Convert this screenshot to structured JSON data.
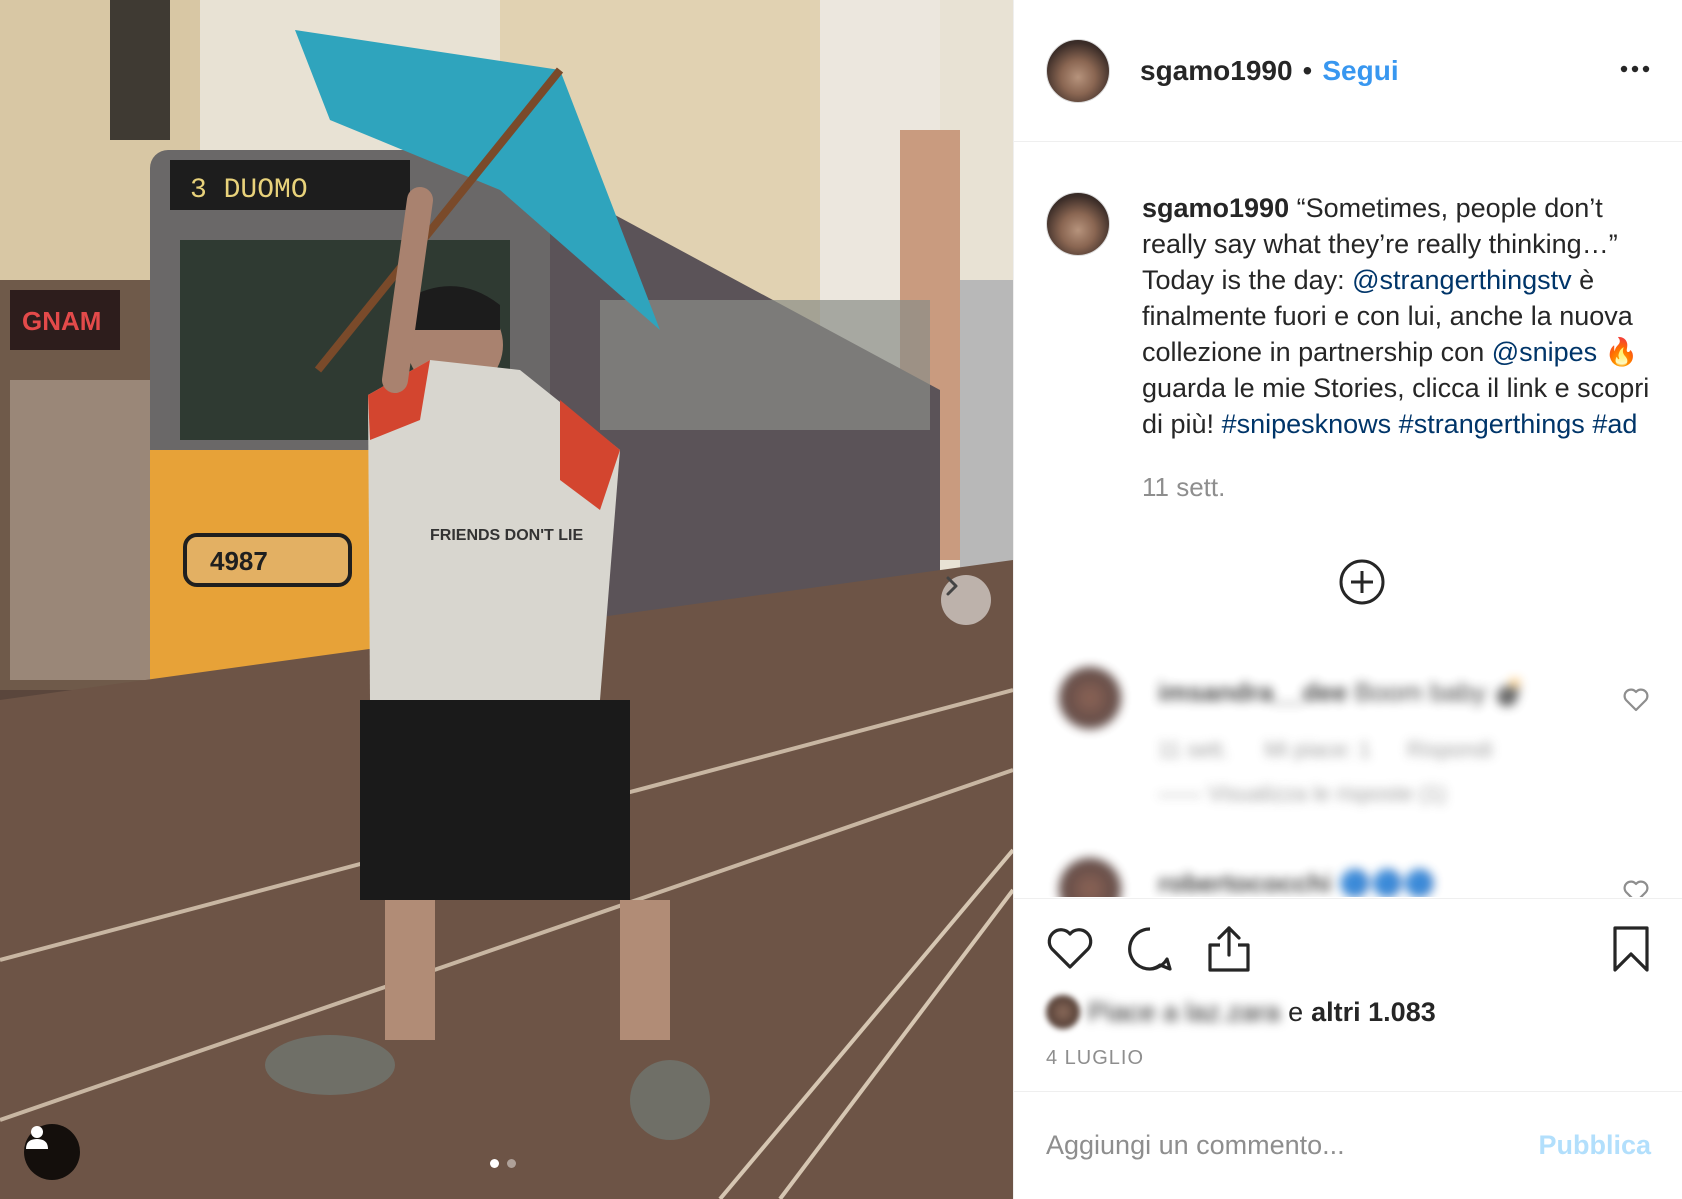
{
  "post": {
    "author": "sgamo1990",
    "separator": "•",
    "follow_label": "Segui",
    "more_icon": "more-options-icon"
  },
  "photo": {
    "tram_sign_text": "3   DUOMO",
    "tram_number": "4987",
    "shop_sign": "GNAM",
    "shirt_text": "FRIENDS DON'T LIE",
    "carousel_pages": 2,
    "carousel_active": 1,
    "next_icon": "chevron-right-icon",
    "tag_icon": "user-tag-icon"
  },
  "caption": {
    "author": "sgamo1990",
    "text_1": " “Sometimes, people don’t really say what they’re really thinking…” Today is the day: ",
    "mention_1": "@strangerthingstv",
    "text_2": " è finalmente fuori e con lui, anche la nuova collezione in partnership con ",
    "mention_2": "@snipes",
    "emoji": "🔥",
    "text_3": "  guarda le mie Stories, clicca il link e scopri di più! ",
    "hashtag_1": "#snipesknows",
    "hashtag_2": "#strangerthings",
    "hashtag_3": "#ad",
    "time": "11 sett.",
    "load_more_icon": "plus-circle-icon"
  },
  "comments": [
    {
      "user": "imsandra__dee",
      "text": "Boom baby 💣",
      "time": "11 sett.",
      "likes": "Mi piace: 1",
      "reply": "Rispondi",
      "view_replies": "Visualizza le risposte (1)"
    },
    {
      "user": "robertococchi",
      "text": "🔵🔵🔵"
    }
  ],
  "actions": {
    "like_icon": "heart-icon",
    "comment_icon": "comment-icon",
    "share_icon": "share-icon",
    "save_icon": "bookmark-icon"
  },
  "likes": {
    "blurred_text": "Piace a laz.zara",
    "and_text": "e",
    "others": "altri 1.083"
  },
  "date": "4 LUGLIO",
  "comment_box": {
    "placeholder": "Aggiungi un commento...",
    "publish_label": "Pubblica"
  },
  "colors": {
    "link_blue": "#3897f0",
    "mention_blue": "#003569",
    "publish_disabled": "#b2dffc",
    "secondary_text": "#8e8e8e",
    "border": "#efefef"
  }
}
